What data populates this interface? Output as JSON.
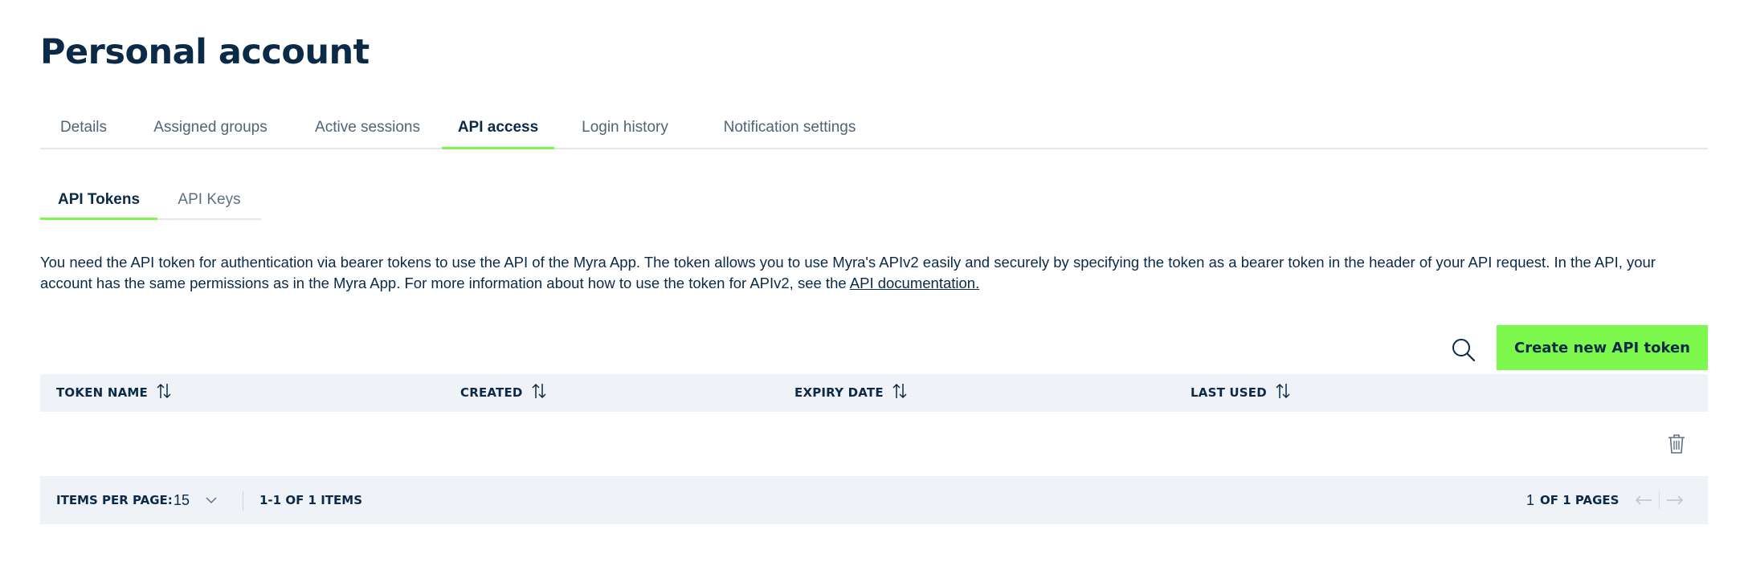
{
  "page": {
    "title": "Personal account"
  },
  "tabs": [
    {
      "label": "Details",
      "active": false
    },
    {
      "label": "Assigned groups",
      "active": false
    },
    {
      "label": "Active sessions",
      "active": false
    },
    {
      "label": "API access",
      "active": true
    },
    {
      "label": "Login history",
      "active": false
    },
    {
      "label": "Notification settings",
      "active": false
    }
  ],
  "subtabs": [
    {
      "label": "API Tokens",
      "active": true
    },
    {
      "label": "API Keys",
      "active": false
    }
  ],
  "description": {
    "text": "You need the API token for authentication via bearer tokens to use the API of the Myra App. The token allows you to use Myra's APIv2 easily and securely by specifying the token as a bearer token in the header of your API request. In the API, your account has the same permissions as in the Myra App. For more information about how to use the token for APIv2, see the ",
    "link": "API documentation."
  },
  "toolbar": {
    "search_icon": "search-icon",
    "create_label": "Create new API token"
  },
  "table": {
    "columns": [
      "TOKEN NAME",
      "CREATED",
      "EXPIRY DATE",
      "LAST USED"
    ],
    "rows": [
      {
        "token_name": "",
        "created": "",
        "expiry_date": "",
        "last_used": "",
        "action_icon": "trash-icon"
      }
    ]
  },
  "pagination": {
    "items_per_page_label": "ITEMS PER PAGE:",
    "items_per_page_value": "15",
    "range": "1-1 OF 1 ITEMS",
    "current_page": "1",
    "of_pages": "OF 1 PAGES"
  },
  "colors": {
    "accent": "#7cf84d",
    "text": "#0b2a47",
    "table_bg": "#eff3f8"
  }
}
